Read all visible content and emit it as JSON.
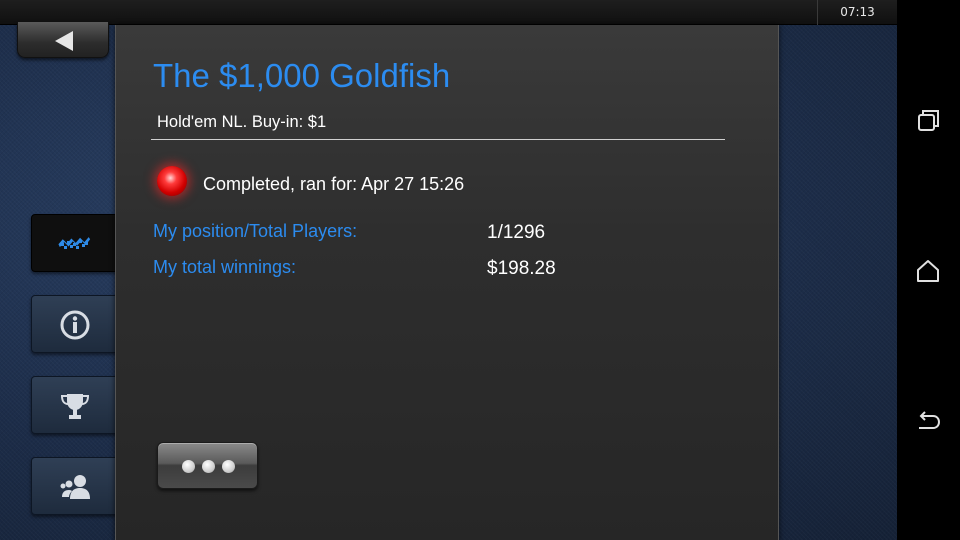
{
  "status_bar": {
    "time": "07:13"
  },
  "tournament": {
    "title": "The $1,000 Goldfish",
    "subtitle": "Hold'em NL. Buy-in: $1",
    "status_text": "Completed, ran for: Apr 27 15:26",
    "status_color": "#ff2020",
    "rows": [
      {
        "label": "My position/Total Players:",
        "value": "1/1296"
      },
      {
        "label": "My total winnings:",
        "value": "$198.28"
      }
    ]
  },
  "side_tabs": [
    {
      "name": "results",
      "icon": "checkered-flag-icon",
      "active": true
    },
    {
      "name": "info",
      "icon": "info-icon",
      "active": false
    },
    {
      "name": "prizes",
      "icon": "trophy-icon",
      "active": false
    },
    {
      "name": "players",
      "icon": "players-icon",
      "active": false
    }
  ],
  "nav": {
    "buttons": [
      "recent-apps-icon",
      "home-icon",
      "back-icon"
    ]
  },
  "colors": {
    "accent": "#2c8cf0",
    "active_pointer": "#1e88e5",
    "panel": "#2e2e2e"
  }
}
